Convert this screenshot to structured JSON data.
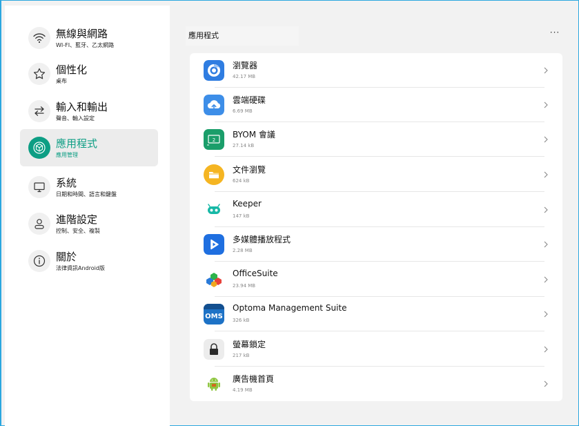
{
  "sidebar": {
    "items": [
      {
        "title": "無線與網路",
        "subtitle": "WI-FI、藍牙、乙太網路",
        "icon": "wifi-icon",
        "active": false
      },
      {
        "title": "個性化",
        "subtitle": "桌布",
        "icon": "star-icon",
        "active": false
      },
      {
        "title": "輸入和輸出",
        "subtitle": "聲音、輸入設定",
        "icon": "swap-arrows-icon",
        "active": false
      },
      {
        "title": "應用程式",
        "subtitle": "應用管理",
        "icon": "app-cube-icon",
        "active": true
      },
      {
        "title": "系統",
        "subtitle": "日期和時間、語言和鍵盤",
        "icon": "monitor-icon",
        "active": false
      },
      {
        "title": "進階設定",
        "subtitle": "控制、安全、複製",
        "icon": "person-icon",
        "active": false
      },
      {
        "title": "關於",
        "subtitle": "法律資訊Android版",
        "icon": "info-icon",
        "active": false
      }
    ]
  },
  "main": {
    "title": "應用程式",
    "more_label": "···"
  },
  "apps": [
    {
      "name": "瀏覽器",
      "size": "42.17 MB",
      "icon": "browser-icon"
    },
    {
      "name": "雲端硬碟",
      "size": "6.69 MB",
      "icon": "cloud-drive-icon"
    },
    {
      "name": "BYOM 會議",
      "size": "27.14 kB",
      "icon": "byom-meeting-icon"
    },
    {
      "name": "文件瀏覽",
      "size": "624 kB",
      "icon": "folder-icon"
    },
    {
      "name": "Keeper",
      "size": "147 kB",
      "icon": "keeper-icon"
    },
    {
      "name": "多媒體播放程式",
      "size": "2.28 MB",
      "icon": "media-player-icon"
    },
    {
      "name": "OfficeSuite",
      "size": "23.94 MB",
      "icon": "officesuite-icon"
    },
    {
      "name": "Optoma Management Suite",
      "size": "326 kB",
      "icon": "oms-icon"
    },
    {
      "name": "螢幕鎖定",
      "size": "217 kB",
      "icon": "lock-icon"
    },
    {
      "name": "廣告機首頁",
      "size": "4.19 MB",
      "icon": "android-icon"
    }
  ],
  "colors": {
    "accent": "#0d9e84",
    "frame": "#2ba7df",
    "background": "#f2f2f2"
  }
}
